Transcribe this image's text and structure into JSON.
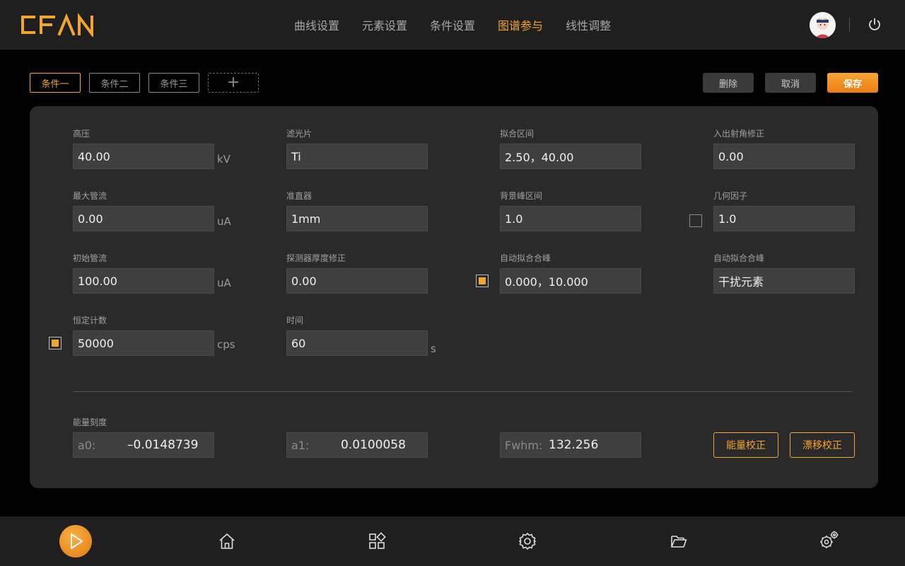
{
  "brand": {
    "logo_text": "CFAN"
  },
  "nav": {
    "items": [
      {
        "label": "曲线设置",
        "active": false
      },
      {
        "label": "元素设置",
        "active": false
      },
      {
        "label": "条件设置",
        "active": false
      },
      {
        "label": "图谱参与",
        "active": true
      },
      {
        "label": "线性调整",
        "active": false
      }
    ]
  },
  "conditions": {
    "tabs": [
      {
        "label": "条件一",
        "active": true
      },
      {
        "label": "条件二",
        "active": false
      },
      {
        "label": "条件三",
        "active": false
      }
    ],
    "add_label": "+"
  },
  "actions": {
    "delete": "删除",
    "cancel": "取消",
    "save": "保存"
  },
  "fields": {
    "high_voltage": {
      "label": "高压",
      "value": "40.00",
      "unit": "kV"
    },
    "max_current": {
      "label": "最大管流",
      "value": "0.00",
      "unit": "uA"
    },
    "init_current": {
      "label": "初始管流",
      "value": "100.00",
      "unit": "uA"
    },
    "const_count": {
      "label": "恒定计数",
      "value": "50000",
      "unit": "cps",
      "checked": true
    },
    "filter": {
      "label": "滤光片",
      "value": "Ti"
    },
    "collimator": {
      "label": "准直器",
      "value": "1mm"
    },
    "detector_thickness": {
      "label": "探测器厚度修正",
      "value": "0.00"
    },
    "time": {
      "label": "时间",
      "value": "60",
      "unit": "s"
    },
    "fit_range": {
      "label": "拟合区间",
      "value": "2.50，40.00"
    },
    "bg_peak_range": {
      "label": "背景峰区间",
      "value": "1.0"
    },
    "auto_fit_peak": {
      "label": "自动拟合合峰",
      "value": "0.000，10.000",
      "checked": true
    },
    "angle_correction": {
      "label": "入出射角修正",
      "value": "0.00"
    },
    "geometry_factor": {
      "label": "几何因子",
      "value": "1.0",
      "checked": false
    },
    "auto_fit_peak2": {
      "label": "自动拟合合峰",
      "value": "干扰元素"
    }
  },
  "calibration": {
    "label": "能量刻度",
    "a0": {
      "prefix": "a0:",
      "value": "–0.0148739"
    },
    "a1": {
      "prefix": "a1:",
      "value": "0.0100058"
    },
    "fwhm": {
      "prefix": "Fwhm:",
      "value": "132.256"
    },
    "energy_btn": "能量校正",
    "drift_btn": "漂移校正"
  },
  "colors": {
    "accent": "#f3a52e",
    "panel": "#2a2a2a",
    "bar": "#1f1f1f"
  },
  "bottom_icons": [
    "play-icon",
    "home-icon",
    "apps-icon",
    "settings-icon",
    "folder-icon",
    "advanced-settings-icon"
  ]
}
